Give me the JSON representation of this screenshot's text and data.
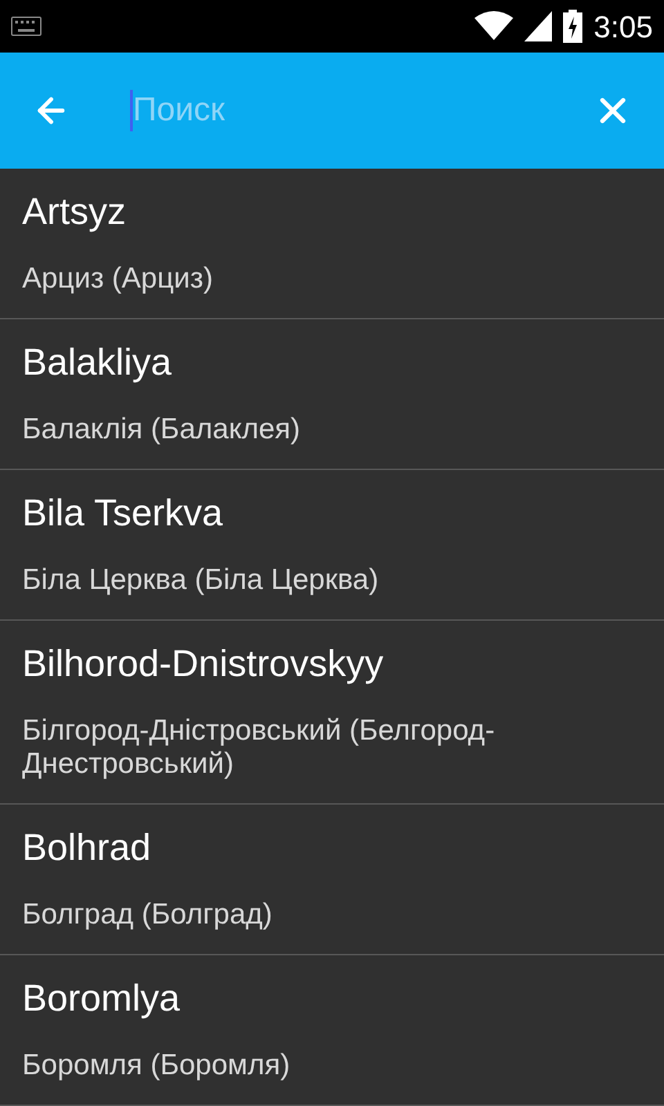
{
  "status_bar": {
    "time": "3:05"
  },
  "search": {
    "placeholder": "Поиск"
  },
  "results": [
    {
      "title": "Artsyz",
      "subtitle": "Арциз (Арциз)"
    },
    {
      "title": "Balakliya",
      "subtitle": "Балаклія (Балаклея)"
    },
    {
      "title": "Bila Tserkva",
      "subtitle": "Біла Церква (Біла Церква)"
    },
    {
      "title": "Bilhorod-Dnistrovskyy",
      "subtitle": "Білгород-Дністровський (Белгород-Днестровський)"
    },
    {
      "title": "Bolhrad",
      "subtitle": "Болград (Болград)"
    },
    {
      "title": "Boromlya",
      "subtitle": "Боромля (Боромля)"
    }
  ]
}
